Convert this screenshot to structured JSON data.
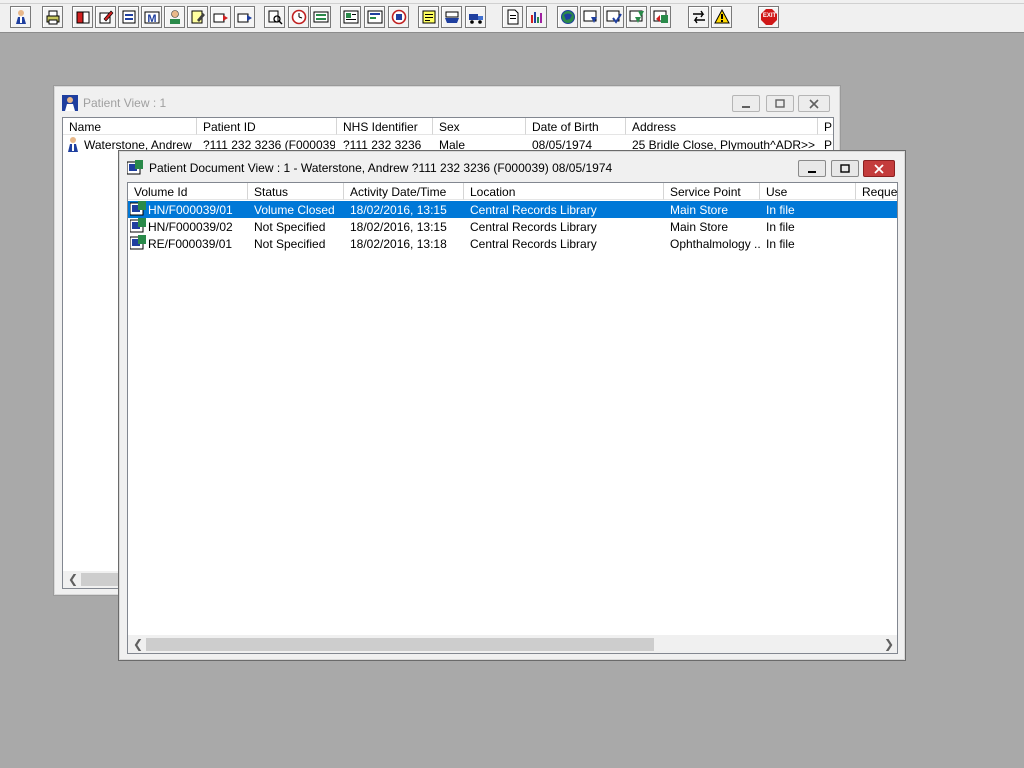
{
  "toolbar": {
    "icons": [
      "patient-search-icon",
      "print-icon",
      "book-red-icon",
      "book-edit-icon",
      "document-list-icon",
      "mail-icon",
      "user-icon",
      "notes-edit-icon",
      "folder-move-icon",
      "folder-send-icon",
      "search-doc-icon",
      "clock-icon",
      "display-icon",
      "request-icon",
      "document-edit-icon",
      "badge-icon",
      "note-yellow-icon",
      "tray-icon",
      "truck-icon",
      "page-icon",
      "bar-chart-icon",
      "globe-icon",
      "doc-down-icon",
      "doc-check-icon",
      "doc-green-icon",
      "doc-refresh-icon",
      "transfer-icon",
      "warning-icon",
      "exit-icon"
    ],
    "exit_label": "EXIT"
  },
  "patient_view": {
    "title": "Patient View : 1",
    "columns": [
      "Name",
      "Patient ID",
      "NHS Identifier",
      "Sex",
      "Date of Birth",
      "Address",
      "P"
    ],
    "rows": [
      {
        "name": "Waterstone, Andrew",
        "patient_id": "?111 232 3236 (F000039)",
        "nhs": "?111 232 3236",
        "sex": "Male",
        "dob": "08/05/1974",
        "address": "25 Bridle Close, Plymouth^ADR>>",
        "p": "P"
      }
    ]
  },
  "document_view": {
    "title": "Patient Document View : 1 - Waterstone, Andrew ?111 232 3236 (F000039) 08/05/1974",
    "columns": [
      "Volume Id",
      "Status",
      "Activity Date/Time",
      "Location",
      "Service Point",
      "Use",
      "Reque:"
    ],
    "rows": [
      {
        "volume_id": "HN/F000039/01",
        "status": "Volume Closed",
        "activity": "18/02/2016, 13:15",
        "location": "Central Records Library",
        "service_point": "Main Store",
        "use": "In file"
      },
      {
        "volume_id": "HN/F000039/02",
        "status": "Not Specified",
        "activity": "18/02/2016, 13:15",
        "location": "Central Records Library",
        "service_point": "Main Store",
        "use": "In file"
      },
      {
        "volume_id": "RE/F000039/01",
        "status": "Not Specified",
        "activity": "18/02/2016, 13:18",
        "location": "Central Records Library",
        "service_point": "Ophthalmology ...",
        "use": "In file"
      }
    ]
  },
  "colors": {
    "selection": "#0078d7",
    "desktop": "#a9a9a9",
    "close_button": "#c43c3c"
  }
}
